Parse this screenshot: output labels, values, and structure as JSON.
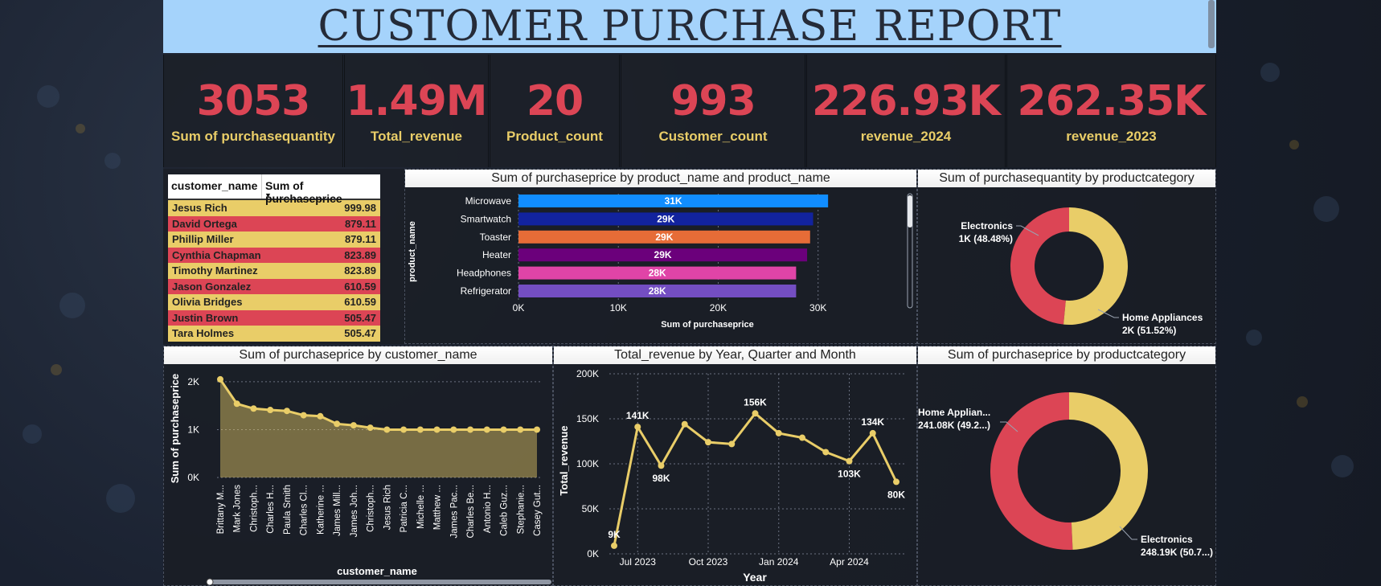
{
  "title": "CUSTOMER PURCHASE REPORT",
  "colors": {
    "accent_red": "#dc4555",
    "accent_yellow": "#e9cd68",
    "title_bg": "#a5d3fb"
  },
  "kpis": [
    {
      "value": "3053",
      "label": "Sum of purchasequantity"
    },
    {
      "value": "1.49M",
      "label": "Total_revenue"
    },
    {
      "value": "20",
      "label": "Product_count"
    },
    {
      "value": "993",
      "label": "Customer_count"
    },
    {
      "value": "226.93K",
      "label": "revenue_2024"
    },
    {
      "value": "262.35K",
      "label": "revenue_2023"
    }
  ],
  "customer_table": {
    "columns": [
      "customer_name",
      "Sum of purchaseprice"
    ],
    "rows": [
      [
        "Jesus Rich",
        "999.98"
      ],
      [
        "David Ortega",
        "879.11"
      ],
      [
        "Phillip Miller",
        "879.11"
      ],
      [
        "Cynthia Chapman",
        "823.89"
      ],
      [
        "Timothy Martinez",
        "823.89"
      ],
      [
        "Jason Gonzalez",
        "610.59"
      ],
      [
        "Olivia Bridges",
        "610.59"
      ],
      [
        "Justin Brown",
        "505.47"
      ],
      [
        "Tara Holmes",
        "505.47"
      ]
    ]
  },
  "chart_data": [
    {
      "type": "bar",
      "orientation": "horizontal",
      "title": "Sum of purchaseprice by product_name and product_name",
      "xlabel": "Sum of purchaseprice",
      "ylabel": "product_name",
      "categories": [
        "Microwave",
        "Smartwatch",
        "Toaster",
        "Heater",
        "Headphones",
        "Refrigerator"
      ],
      "values": [
        31000,
        29500,
        29200,
        28900,
        27800,
        27800
      ],
      "data_labels": [
        "31K",
        "29K",
        "29K",
        "29K",
        "28K",
        "28K"
      ],
      "bar_colors": [
        "#118dff",
        "#12239e",
        "#e66c37",
        "#6b007b",
        "#e044a7",
        "#744ec2"
      ],
      "xticks": [
        "0K",
        "10K",
        "20K",
        "30K"
      ],
      "xlim": [
        0,
        33000
      ],
      "grid": true
    },
    {
      "type": "pie",
      "subtype": "donut",
      "title": "Sum of purchasequantity by productcategory",
      "slices": [
        {
          "name": "Electronics",
          "value": 48.48,
          "label_line1": "Electronics",
          "label_line2": "1K (48.48%)",
          "color": "#dc4555"
        },
        {
          "name": "Home Appliances",
          "value": 51.52,
          "label_line1": "Home Appliances",
          "label_line2": "2K (51.52%)",
          "color": "#e9cd68"
        }
      ]
    },
    {
      "type": "area",
      "title": "Sum of purchaseprice by customer_name",
      "xlabel": "customer_name",
      "ylabel": "Sum of purchaseprice",
      "categories": [
        "Brittany M...",
        "Mark Jones",
        "Christoph...",
        "Charles H...",
        "Paula Smith",
        "Charles Cl...",
        "Katherine ...",
        "James Mill...",
        "James Joh...",
        "Christoph...",
        "Jesus Rich",
        "Patricia C...",
        "Michelle ...",
        "Matthew ...",
        "James Pac...",
        "Charles Be...",
        "Antonio H...",
        "Caleb Guz...",
        "Stephanie...",
        "Casey Gut..."
      ],
      "values": [
        2050,
        1540,
        1440,
        1410,
        1390,
        1300,
        1280,
        1120,
        1090,
        1040,
        1000,
        1000,
        1000,
        1000,
        1000,
        1000,
        1000,
        1000,
        1000,
        1000
      ],
      "yticks": [
        "0K",
        "1K",
        "2K"
      ],
      "ylim": [
        0,
        2200
      ],
      "color": "#e9cd68"
    },
    {
      "type": "line",
      "title": "Total_revenue by Year, Quarter and Month",
      "xlabel": "Year",
      "ylabel": "Total_revenue",
      "values": [
        9000,
        141000,
        98000,
        144000,
        124000,
        122000,
        156000,
        134000,
        129000,
        113000,
        103000,
        134000,
        80000
      ],
      "point_labels": [
        "9K",
        "141K",
        "98K",
        "",
        "",
        "",
        "156K",
        "",
        "",
        "",
        "103K",
        "134K",
        "80K"
      ],
      "xticks": [
        "Jul 2023",
        "Oct 2023",
        "Jan 2024",
        "Apr 2024"
      ],
      "yticks": [
        "0K",
        "50K",
        "100K",
        "150K",
        "200K"
      ],
      "ylim": [
        0,
        200000
      ],
      "color": "#e9cd68"
    },
    {
      "type": "pie",
      "subtype": "donut",
      "title": "Sum of purchaseprice by productcategory",
      "slices": [
        {
          "name": "Electronics",
          "value": 248.19,
          "label_line1": "Electronics",
          "label_line2": "248.19K (50.7...)",
          "color": "#dc4555"
        },
        {
          "name": "Home Appliances",
          "value": 241.08,
          "label_line1": "Home Applian...",
          "label_line2": "241.08K (49.2...)",
          "color": "#e9cd68"
        }
      ]
    }
  ]
}
